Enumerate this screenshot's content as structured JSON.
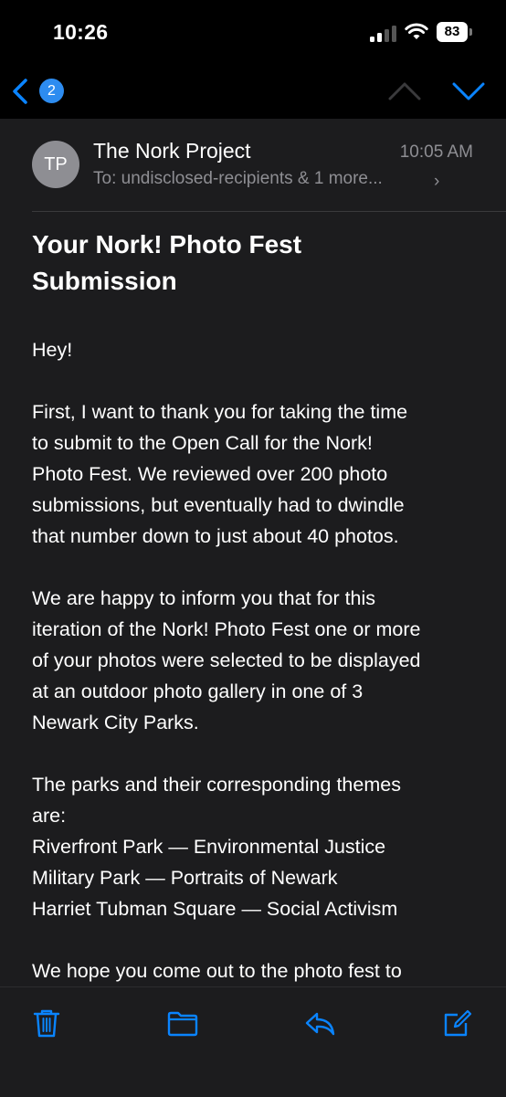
{
  "status_bar": {
    "time": "10:26",
    "battery": "83"
  },
  "nav": {
    "unread_count": "2",
    "icons": [
      "back-chevron-icon",
      "previous-message-icon",
      "next-message-icon"
    ]
  },
  "email": {
    "avatar_initials": "TP",
    "sender": "The Nork Project",
    "time": "10:05 AM",
    "to_label": "To:",
    "recipients": "undisclosed-recipients & 1 more...",
    "subject_line1": "Your Nork! Photo Fest",
    "subject_line2": "Submission",
    "greeting": "Hey!",
    "para1_lines": [
      "First, I want to thank you for taking the time",
      "to submit to the Open Call for the Nork!",
      "Photo Fest. We reviewed over 200 photo",
      "submissions, but eventually had to dwindle",
      "that number down to just about 40 photos."
    ],
    "para2_lines": [
      "We are happy to inform you that for this",
      "iteration of the Nork! Photo Fest one or more",
      "of your photos were selected to be displayed",
      "at an outdoor photo gallery in one of 3",
      "Newark City Parks."
    ],
    "para3_lines": [
      "The parks and their corresponding themes",
      "are:",
      "Riverfront Park — Environmental Justice",
      "Military Park — Portraits of Newark",
      "Harriet Tubman Square — Social Activism"
    ],
    "para4_line1": "We hope you come out to the photo fest to"
  },
  "toolbar": {
    "icons": [
      "trash-icon",
      "folder-icon",
      "reply-icon",
      "compose-icon"
    ]
  },
  "colors": {
    "accent": "#0a84ff",
    "background": "#1c1c1e",
    "secondary_text": "#8e8e93"
  }
}
